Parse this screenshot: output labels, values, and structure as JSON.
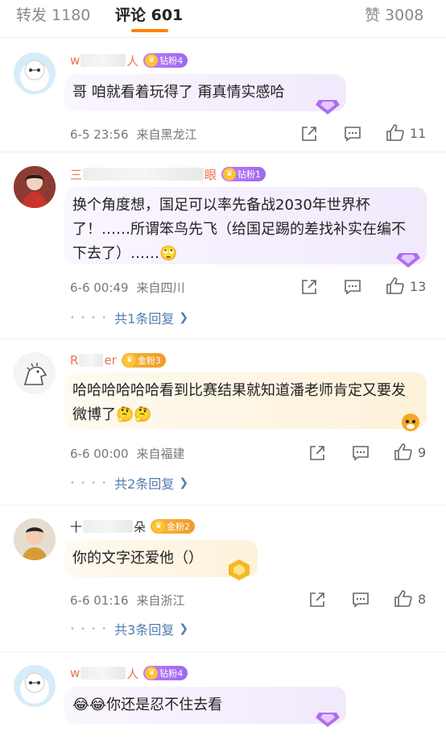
{
  "tabs": [
    {
      "label": "转发 1180"
    },
    {
      "label": "评论 601"
    },
    {
      "label": "赞 3008"
    }
  ],
  "comments": [
    {
      "user_visible_start": "w",
      "user_visible_end": "人",
      "badge": "钻粉4",
      "text": "哥 咱就看着玩得了 甭真情实感哈",
      "date": "6-5 23:56",
      "location": "来自黑龙江",
      "likes": "11"
    },
    {
      "user_visible_start": "三",
      "user_visible_end": "眼",
      "badge": "钻粉1",
      "text": "换个角度想，国足可以率先备战2030年世界杯了！……所谓笨鸟先飞（给国足踢的差找补实在编不下去了）……🙄",
      "date": "6-6 00:49",
      "location": "来自四川",
      "likes": "13",
      "replies": "共1条回复"
    },
    {
      "user_visible_start": "R",
      "user_visible_end": "er",
      "badge": "金粉3",
      "text": "哈哈哈哈哈哈看到比赛结果就知道潘老师肯定又要发微博了🤔🤔",
      "date": "6-6 00:00",
      "location": "来自福建",
      "likes": "9",
      "replies": "共2条回复"
    },
    {
      "user_visible_start": "十",
      "user_visible_end": "朵",
      "badge": "金粉2",
      "text": "你的文字还爱他（）",
      "date": "6-6 01:16",
      "location": "来自浙江",
      "likes": "8",
      "replies": "共3条回复"
    },
    {
      "user_visible_start": "w",
      "user_visible_end": "人",
      "badge": "钻粉4",
      "text": "😂😂你还是忍不住去看",
      "date": "",
      "location": "",
      "likes": ""
    }
  ],
  "colors": {
    "accent": "#ff8200",
    "username": "#eb7350",
    "reply_link": "#507daf"
  },
  "icons": [
    "share-icon",
    "comment-icon",
    "like-icon",
    "chevron-right-icon"
  ]
}
